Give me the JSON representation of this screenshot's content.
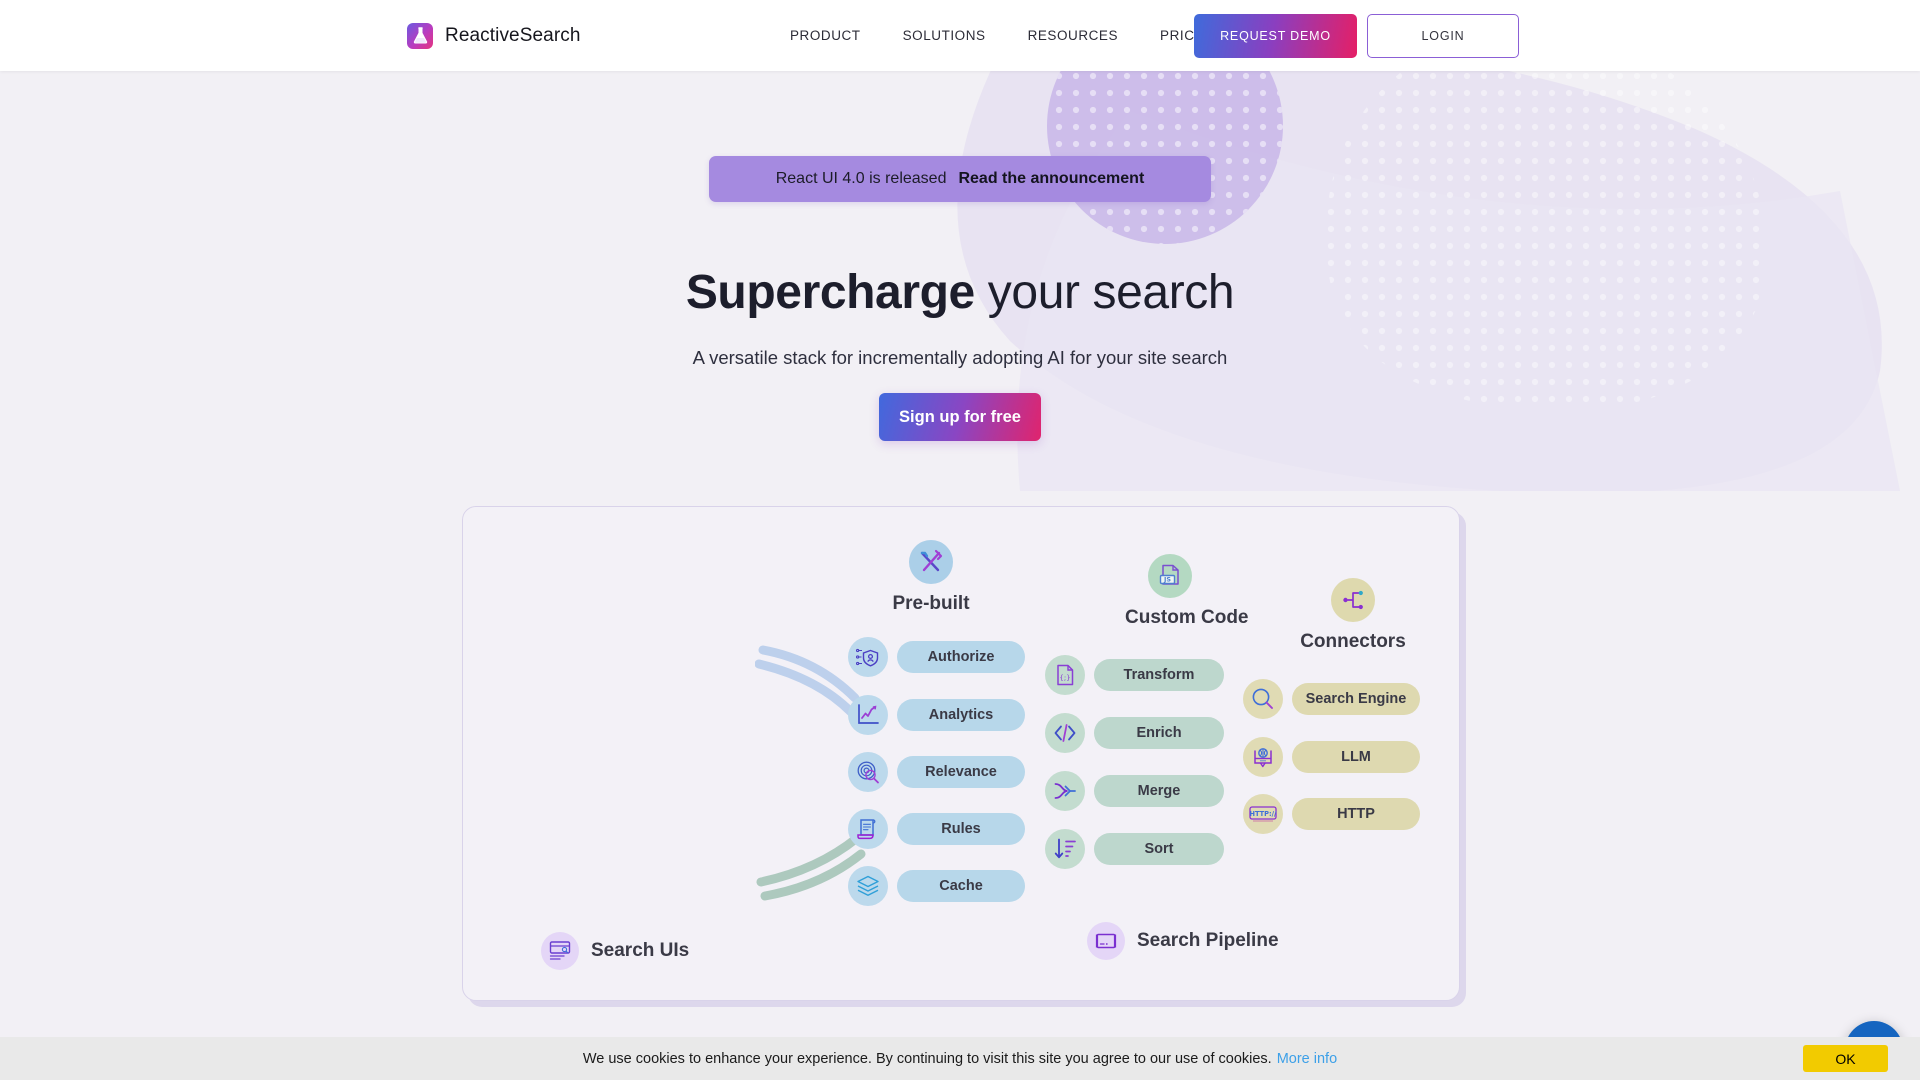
{
  "header": {
    "brand": {
      "name": "ReactiveSearch",
      "icon": "flask-logo-icon"
    },
    "nav": [
      {
        "label": "PRODUCT"
      },
      {
        "label": "SOLUTIONS"
      },
      {
        "label": "RESOURCES"
      },
      {
        "label": "PRICING"
      }
    ],
    "demo_button": "REQUEST DEMO",
    "login_button": "LOGIN"
  },
  "hero": {
    "announcement": {
      "text": "React UI 4.0 is released",
      "link": "Read the announcement"
    },
    "title_strong": "Supercharge",
    "title_rest": " your search",
    "subtitle": "A versatile stack for incrementally adopting AI for your site search",
    "cta": "Sign up for free"
  },
  "diagram": {
    "columns": [
      {
        "title": "Pre-built",
        "icon": "tools-cross-icon",
        "icon_bg": "#abcfe8",
        "pill_bg": "#b7d7ea",
        "row_icon_bg": "#bcd9ec",
        "items": [
          {
            "label": "Authorize",
            "icon": "shield-user-network-icon"
          },
          {
            "label": "Analytics",
            "icon": "line-chart-icon"
          },
          {
            "label": "Relevance",
            "icon": "target-magnifier-icon"
          },
          {
            "label": "Rules",
            "icon": "scroll-document-icon"
          },
          {
            "label": "Cache",
            "icon": "layers-stack-icon"
          }
        ]
      },
      {
        "title": "Custom Code",
        "icon": "js-file-icon",
        "icon_bg": "#b4d9c2",
        "pill_bg": "#bdd7cd",
        "row_icon_bg": "#c3dccf",
        "items": [
          {
            "label": "Transform",
            "icon": "json-file-icon"
          },
          {
            "label": "Enrich",
            "icon": "code-brackets-icon"
          },
          {
            "label": "Merge",
            "icon": "merge-arrows-icon"
          },
          {
            "label": "Sort",
            "icon": "sort-descending-icon"
          }
        ]
      },
      {
        "title": "Connectors",
        "icon": "node-tree-icon",
        "icon_bg": "#ded9ae",
        "pill_bg": "#ded9b0",
        "row_icon_bg": "#e0dbb4",
        "items": [
          {
            "label": "Search Engine",
            "icon": "magnifier-icon"
          },
          {
            "label": "LLM",
            "icon": "brain-book-icon"
          },
          {
            "label": "HTTP",
            "icon": "http-badge-icon"
          }
        ]
      }
    ],
    "footer_labels": [
      {
        "label": "Search UIs",
        "icon": "ui-window-icon"
      },
      {
        "label": "Search Pipeline",
        "icon": "pipeline-icon"
      }
    ]
  },
  "cookie": {
    "text": "We use cookies to enhance your experience. By continuing to visit this site you agree to our use of cookies.",
    "link": "More info",
    "ok": "OK"
  },
  "chat": {
    "icon": "chat-bubble-icon"
  },
  "colors": {
    "page_bg": "#f2f0f5",
    "accent_gradient_start": "#4169dd",
    "accent_gradient_end": "#e0246d",
    "announce_bg": "#a58ae0",
    "cookie_button": "#f2cb00",
    "cookie_link": "#3da0e8",
    "chat_widget": "#1565c0"
  }
}
